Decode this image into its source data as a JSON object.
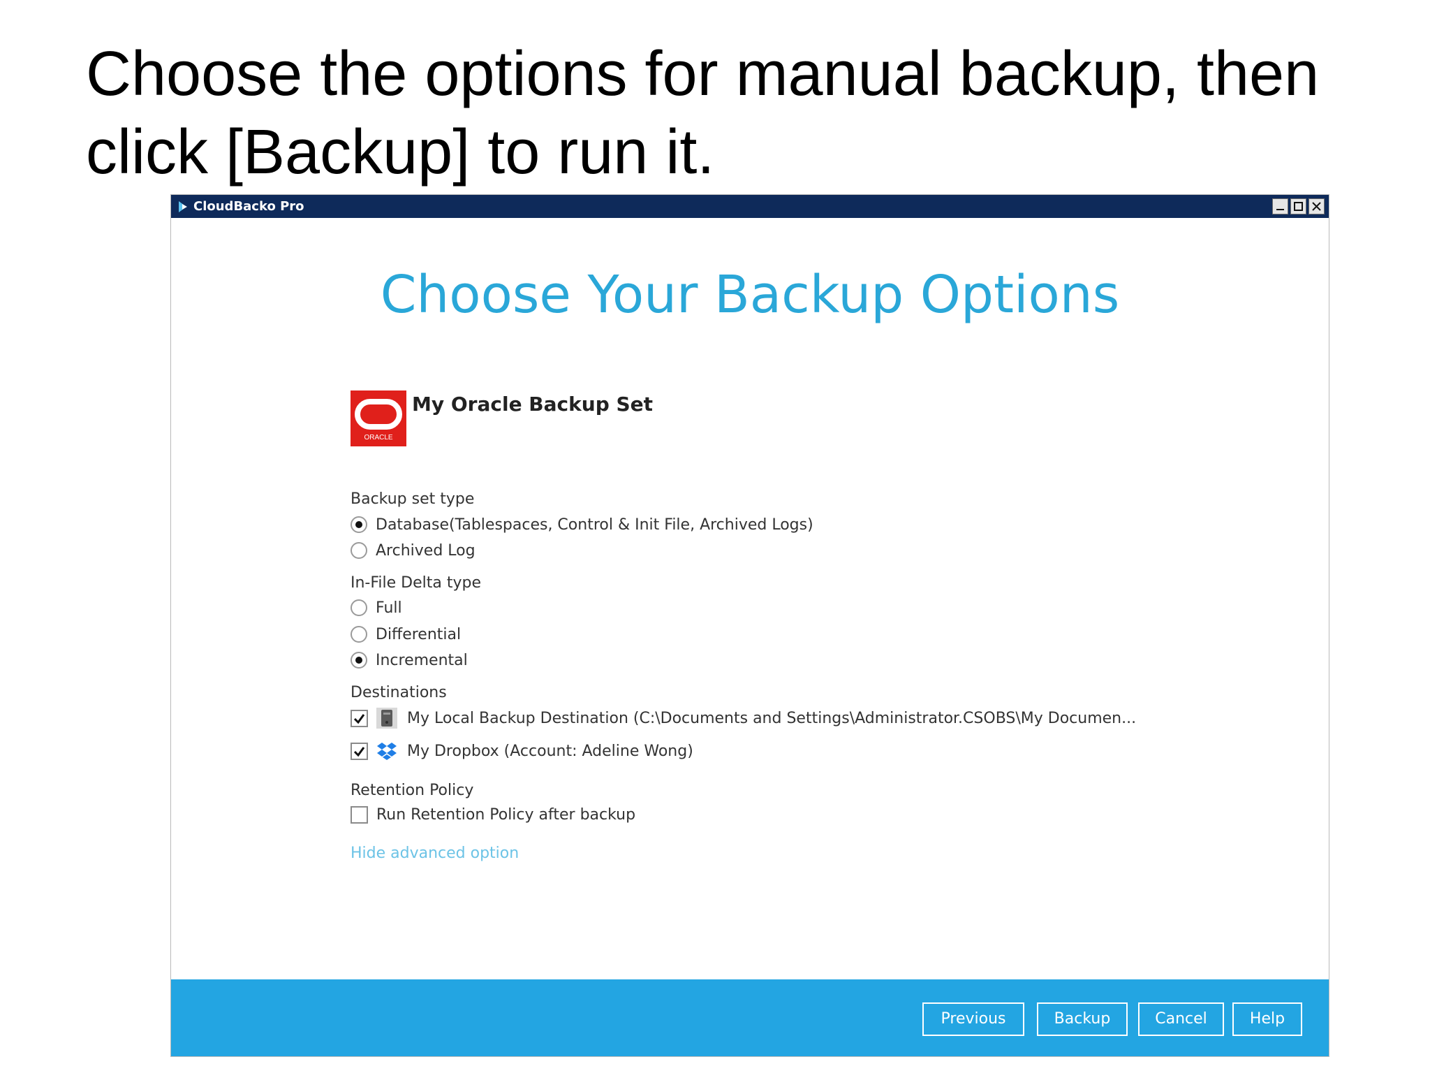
{
  "slide": {
    "title": "Choose the options for manual backup, then click [Backup] to run it."
  },
  "window": {
    "app_name": "CloudBacko Pro"
  },
  "dialog": {
    "heading": "Choose Your Backup Options",
    "backup_set_name": "My Oracle Backup Set",
    "logo_text": "ORACLE",
    "backup_set_type": {
      "label": "Backup set type",
      "options": [
        {
          "label": "Database(Tablespaces, Control & Init File, Archived Logs)",
          "selected": true
        },
        {
          "label": "Archived Log",
          "selected": false
        }
      ]
    },
    "in_file_delta": {
      "label": "In-File Delta type",
      "options": [
        {
          "label": "Full",
          "selected": false
        },
        {
          "label": "Differential",
          "selected": false
        },
        {
          "label": "Incremental",
          "selected": true
        }
      ]
    },
    "destinations": {
      "label": "Destinations",
      "items": [
        {
          "label": "My Local Backup Destination (C:\\Documents and Settings\\Administrator.CSOBS\\My Documen...",
          "checked": true,
          "icon": "local-drive-icon"
        },
        {
          "label": "My Dropbox (Account: Adeline Wong)",
          "checked": true,
          "icon": "dropbox-icon"
        }
      ]
    },
    "retention": {
      "label": "Retention Policy",
      "option": {
        "label": "Run Retention Policy after backup",
        "checked": false
      }
    },
    "advanced_link": "Hide advanced option"
  },
  "footer": {
    "previous": "Previous",
    "backup": "Backup",
    "cancel": "Cancel",
    "help": "Help"
  },
  "colors": {
    "accent": "#2aa7d8",
    "footer": "#23a5e2",
    "titlebar": "#0e2a5a",
    "oracle_red": "#e0201b"
  }
}
